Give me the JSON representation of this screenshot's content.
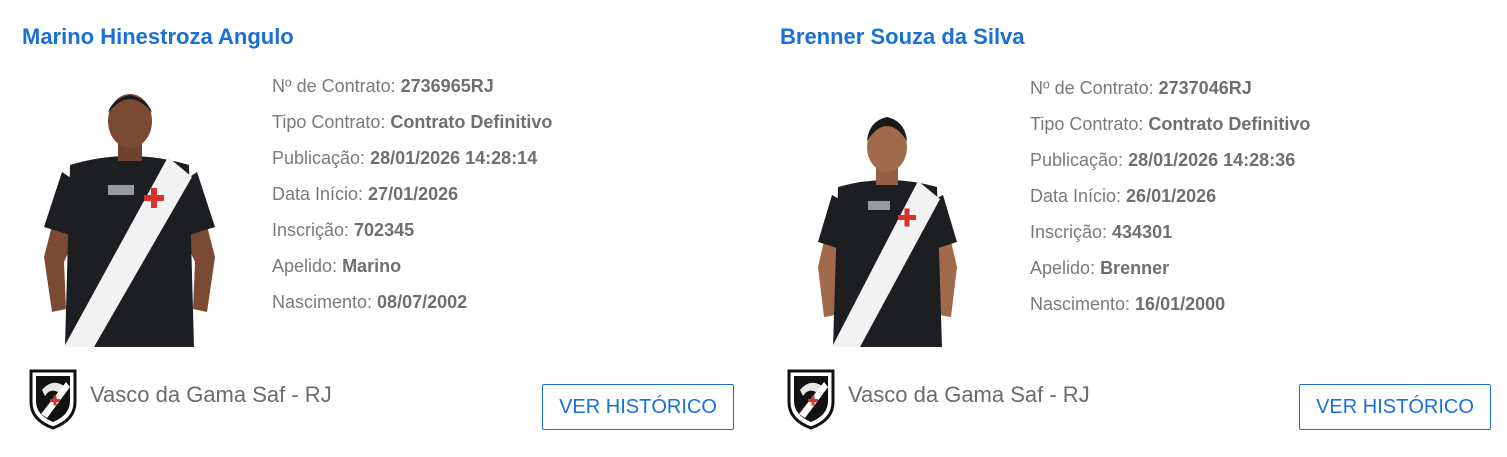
{
  "players": [
    {
      "name": "Marino Hinestroza Angulo",
      "fields": [
        {
          "label": "Nº de Contrato: ",
          "value": "2736965RJ"
        },
        {
          "label": "Tipo Contrato: ",
          "value": "Contrato Definitivo"
        },
        {
          "label": "Publicação: ",
          "value": "28/01/2026 14:28:14"
        },
        {
          "label": "Data Início: ",
          "value": "27/01/2026"
        },
        {
          "label": "Inscrição: ",
          "value": "702345"
        },
        {
          "label": "Apelido: ",
          "value": "Marino"
        },
        {
          "label": "Nascimento: ",
          "value": "08/07/2002"
        }
      ],
      "club": "Vasco da Gama Saf - RJ",
      "button": "VER HISTÓRICO"
    },
    {
      "name": "Brenner Souza da Silva",
      "fields": [
        {
          "label": "Nº de Contrato: ",
          "value": "2737046RJ"
        },
        {
          "label": "Tipo Contrato: ",
          "value": "Contrato Definitivo"
        },
        {
          "label": "Publicação: ",
          "value": "28/01/2026 14:28:36"
        },
        {
          "label": "Data Início: ",
          "value": "26/01/2026"
        },
        {
          "label": "Inscrição: ",
          "value": "434301"
        },
        {
          "label": "Apelido: ",
          "value": "Brenner"
        },
        {
          "label": "Nascimento: ",
          "value": "16/01/2000"
        }
      ],
      "club": "Vasco da Gama Saf - RJ",
      "button": "VER HISTÓRICO"
    }
  ],
  "colors": {
    "accent": "#1a6fd8",
    "jersey": "#1c1e22",
    "sash": "#f2f2f2",
    "cross": "#d8322c"
  },
  "icons": {
    "player_photo": "player-photo-icon",
    "club_crest": "vasco-crest-icon"
  }
}
